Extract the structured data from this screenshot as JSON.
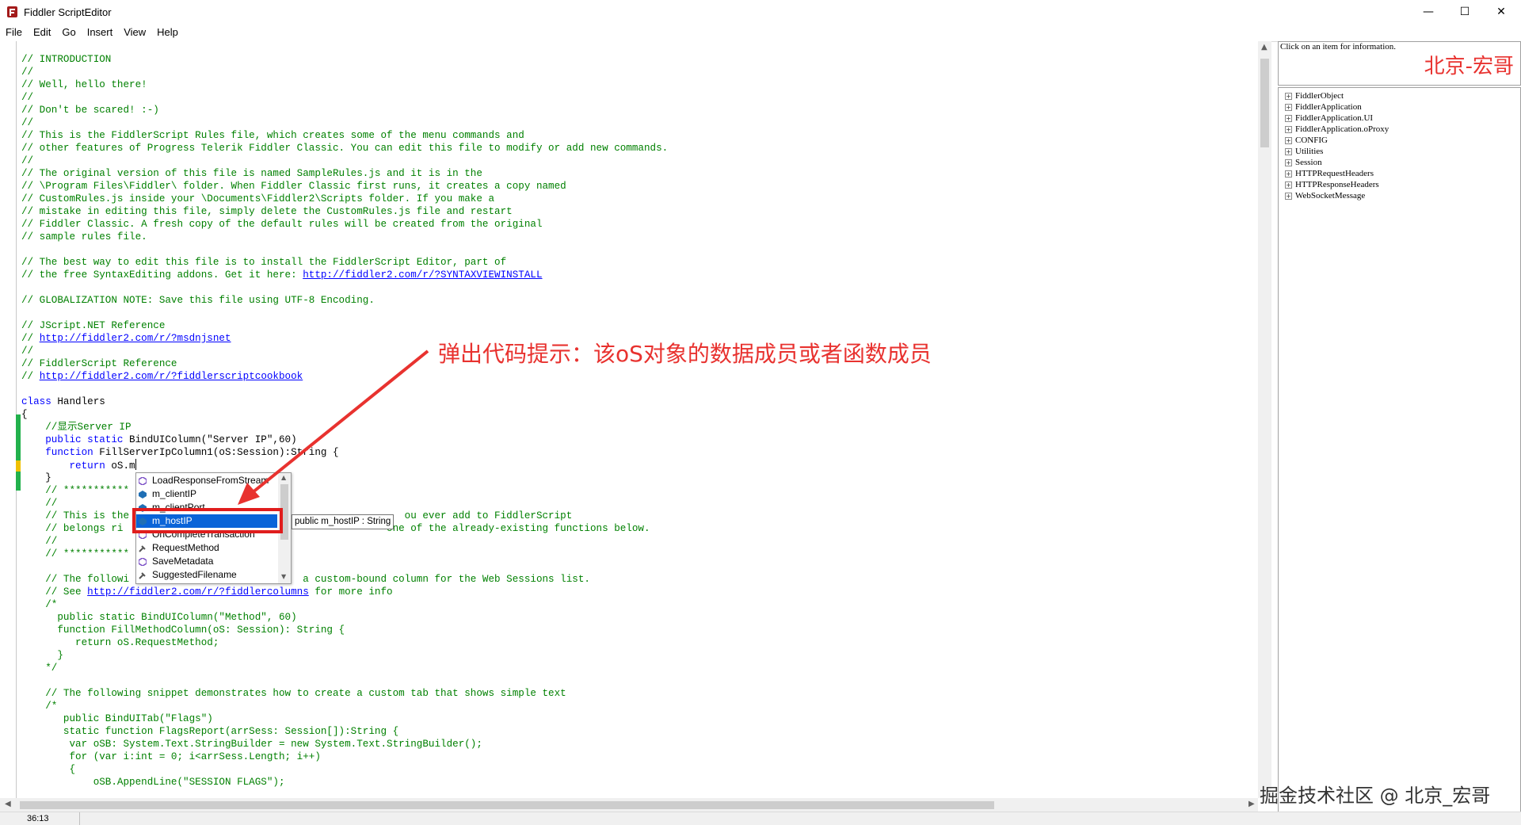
{
  "window": {
    "title": "Fiddler ScriptEditor",
    "minimize_glyph": "—",
    "maximize_glyph": "☐",
    "close_glyph": "✕"
  },
  "menu": [
    "File",
    "Edit",
    "Go",
    "Insert",
    "View",
    "Help"
  ],
  "code_lines": [
    [
      {
        "c": "cm",
        "t": "// INTRODUCTION"
      }
    ],
    [
      {
        "c": "cm",
        "t": "//"
      }
    ],
    [
      {
        "c": "cm",
        "t": "// Well, hello there!"
      }
    ],
    [
      {
        "c": "cm",
        "t": "//"
      }
    ],
    [
      {
        "c": "cm",
        "t": "// Don't be scared! :-)"
      }
    ],
    [
      {
        "c": "cm",
        "t": "//"
      }
    ],
    [
      {
        "c": "cm",
        "t": "// This is the FiddlerScript Rules file, which creates some of the menu commands and"
      }
    ],
    [
      {
        "c": "cm",
        "t": "// other features of Progress Telerik Fiddler Classic. You can edit this file to modify or add new commands."
      }
    ],
    [
      {
        "c": "cm",
        "t": "//"
      }
    ],
    [
      {
        "c": "cm",
        "t": "// The original version of this file is named SampleRules.js and it is in the"
      }
    ],
    [
      {
        "c": "cm",
        "t": "// \\Program Files\\Fiddler\\ folder. When Fiddler Classic first runs, it creates a copy named"
      }
    ],
    [
      {
        "c": "cm",
        "t": "// CustomRules.js inside your \\Documents\\Fiddler2\\Scripts folder. If you make a"
      }
    ],
    [
      {
        "c": "cm",
        "t": "// mistake in editing this file, simply delete the CustomRules.js file and restart"
      }
    ],
    [
      {
        "c": "cm",
        "t": "// Fiddler Classic. A fresh copy of the default rules will be created from the original"
      }
    ],
    [
      {
        "c": "cm",
        "t": "// sample rules file."
      }
    ],
    [],
    [
      {
        "c": "cm",
        "t": "// The best way to edit this file is to install the FiddlerScript Editor, part of"
      }
    ],
    [
      {
        "c": "cm",
        "t": "// the free SyntaxEditing addons. Get it here: "
      },
      {
        "c": "url",
        "t": "http://fiddler2.com/r/?SYNTAXVIEWINSTALL"
      }
    ],
    [],
    [
      {
        "c": "cm",
        "t": "// GLOBALIZATION NOTE: Save this file using UTF-8 Encoding."
      }
    ],
    [],
    [
      {
        "c": "cm",
        "t": "// JScript.NET Reference"
      }
    ],
    [
      {
        "c": "cm",
        "t": "// "
      },
      {
        "c": "url",
        "t": "http://fiddler2.com/r/?msdnjsnet"
      }
    ],
    [
      {
        "c": "cm",
        "t": "//"
      }
    ],
    [
      {
        "c": "cm",
        "t": "// FiddlerScript Reference"
      }
    ],
    [
      {
        "c": "cm",
        "t": "// "
      },
      {
        "c": "url",
        "t": "http://fiddler2.com/r/?fiddlerscriptcookbook"
      }
    ],
    [],
    [
      {
        "c": "kw",
        "t": "class"
      },
      {
        "c": "",
        "t": " Handlers"
      }
    ],
    [
      {
        "c": "",
        "t": "{"
      }
    ],
    [
      {
        "c": "cm",
        "t": "    //显示Server IP"
      }
    ],
    [
      {
        "c": "kw",
        "t": "    public static"
      },
      {
        "c": "",
        "t": " BindUIColumn(\"Server IP\",60)"
      }
    ],
    [
      {
        "c": "kw",
        "t": "    function"
      },
      {
        "c": "",
        "t": " FillServerIpColumn1(oS:Session):String {"
      }
    ],
    [
      {
        "c": "kw",
        "t": "        return"
      },
      {
        "c": "",
        "t": " oS.m"
      },
      {
        "c": "caret",
        "t": ""
      }
    ],
    [
      {
        "c": "",
        "t": "    }"
      }
    ],
    [
      {
        "c": "cm",
        "t": "    // ***********                                           "
      }
    ],
    [
      {
        "c": "cm",
        "t": "    //"
      }
    ],
    [
      {
        "c": "cm",
        "t": "    // This is the                                              ou ever add to FiddlerScript"
      }
    ],
    [
      {
        "c": "cm",
        "t": "    // belongs ri                                            one of the already-existing functions below."
      }
    ],
    [
      {
        "c": "cm",
        "t": "    //"
      }
    ],
    [
      {
        "c": "cm",
        "t": "    // ***********"
      }
    ],
    [],
    [
      {
        "c": "cm",
        "t": "    // The followi                             a custom-bound column for the Web Sessions list."
      }
    ],
    [
      {
        "c": "cm",
        "t": "    // See "
      },
      {
        "c": "url",
        "t": "http://fiddler2.com/r/?fiddlercolumns"
      },
      {
        "c": "cm",
        "t": " for more info"
      }
    ],
    [
      {
        "c": "cm",
        "t": "    /*"
      }
    ],
    [
      {
        "c": "cm",
        "t": "      public static BindUIColumn(\"Method\", 60)"
      }
    ],
    [
      {
        "c": "cm",
        "t": "      function FillMethodColumn(oS: Session): String {"
      }
    ],
    [
      {
        "c": "cm",
        "t": "         return oS.RequestMethod;"
      }
    ],
    [
      {
        "c": "cm",
        "t": "      }"
      }
    ],
    [
      {
        "c": "cm",
        "t": "    */"
      }
    ],
    [],
    [
      {
        "c": "cm",
        "t": "    // The following snippet demonstrates how to create a custom tab that shows simple text"
      }
    ],
    [
      {
        "c": "cm",
        "t": "    /*"
      }
    ],
    [
      {
        "c": "cm",
        "t": "       public BindUITab(\"Flags\")"
      }
    ],
    [
      {
        "c": "cm",
        "t": "       static function FlagsReport(arrSess: Session[]):String {"
      }
    ],
    [
      {
        "c": "cm",
        "t": "        var oSB: System.Text.StringBuilder = new System.Text.StringBuilder();"
      }
    ],
    [
      {
        "c": "cm",
        "t": "        for (var i:int = 0; i<arrSess.Length; i++)"
      }
    ],
    [
      {
        "c": "cm",
        "t": "        {"
      }
    ],
    [
      {
        "c": "cm",
        "t": "            oSB.AppendLine(\"SESSION FLAGS\");"
      }
    ]
  ],
  "autocomplete": {
    "items": [
      {
        "label": "LoadResponseFromStream",
        "icon": "method"
      },
      {
        "label": "m_clientIP",
        "icon": "field"
      },
      {
        "label": "m_clientPort",
        "icon": "field"
      },
      {
        "label": "m_hostIP",
        "icon": "field"
      },
      {
        "label": "OnCompleteTransaction",
        "icon": "method"
      },
      {
        "label": "RequestMethod",
        "icon": "property"
      },
      {
        "label": "SaveMetadata",
        "icon": "method"
      },
      {
        "label": "SuggestedFilename",
        "icon": "property"
      }
    ],
    "selected_index": 3,
    "tooltip": "public m_hostIP : String"
  },
  "right_panel": {
    "info_text": "Click on an item for information.",
    "tree_items": [
      "FiddlerObject",
      "FiddlerApplication",
      "FiddlerApplication.UI",
      "FiddlerApplication.oProxy",
      "CONFIG",
      "Utilities",
      "Session",
      "HTTPRequestHeaders",
      "HTTPResponseHeaders",
      "WebSocketMessage"
    ],
    "expander_glyph": "+"
  },
  "annotations": {
    "callout": "弹出代码提示：该oS对象的数据成员或者函数成员",
    "watermark_top": "北京-宏哥",
    "watermark_bottom": "掘金技术社区 @ 北京_宏哥"
  },
  "status": {
    "position": "36:13"
  },
  "colors": {
    "comment": "#008000",
    "keyword": "#0000ff",
    "selection": "#0a64d8",
    "annotation_red": "#e8322f",
    "changed_line": "#22b14c",
    "current_line": "#f0c000"
  },
  "icons": {
    "app": "fiddler-icon",
    "method": "method-icon",
    "field": "field-icon",
    "property": "property-icon"
  }
}
